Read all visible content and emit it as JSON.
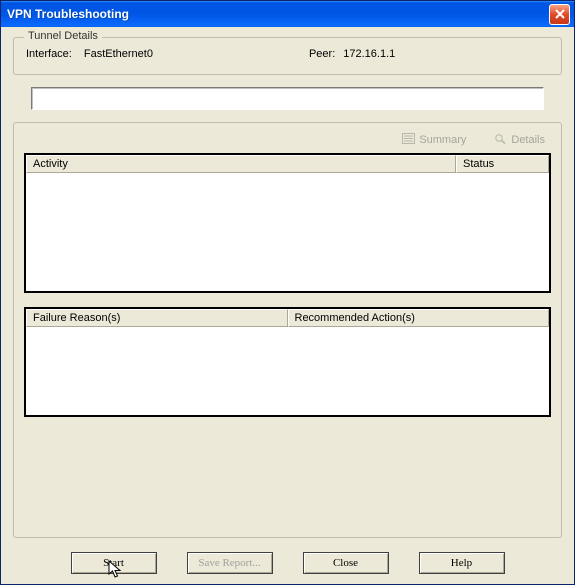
{
  "window": {
    "title": "VPN Troubleshooting"
  },
  "tunnel": {
    "legend": "Tunnel Details",
    "interface_label": "Interface:",
    "interface_value": "FastEthernet0",
    "peer_label": "Peer:",
    "peer_value": "172.16.1.1"
  },
  "search": {
    "value": ""
  },
  "tabs": {
    "summary": "Summary",
    "details": "Details"
  },
  "table1": {
    "col_activity": "Activity",
    "col_status": "Status"
  },
  "table2": {
    "col_reason": "Failure Reason(s)",
    "col_action": "Recommended Action(s)"
  },
  "buttons": {
    "start": "Start",
    "save": "Save Report...",
    "close": "Close",
    "help": "Help"
  }
}
